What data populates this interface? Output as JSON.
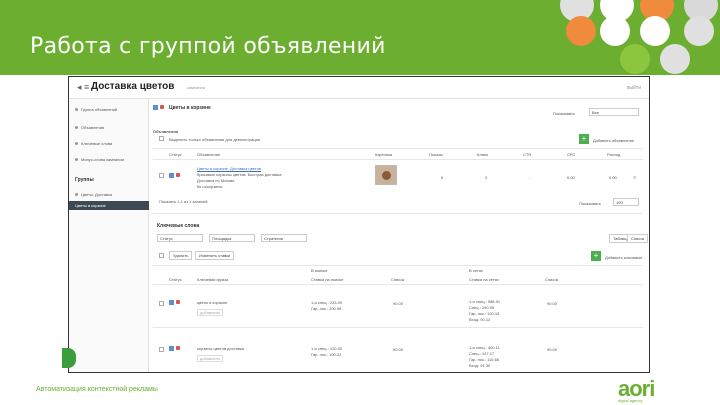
{
  "slide": {
    "title": "Работа с группой объявлений",
    "footer": "Автоматизация контекстной рекламы",
    "logo": "aori",
    "logo_sub": "digital agency",
    "colors": {
      "brand": "#6cae30"
    }
  },
  "app": {
    "back_icon": "back-arrow-icon",
    "title": "Доставка цветов",
    "subtitle": "кампания",
    "top_right": "выйти"
  },
  "sidebar": {
    "items": [
      {
        "label": "Группа объявлений"
      },
      {
        "label": "Объявления"
      },
      {
        "label": "Ключевые слова"
      },
      {
        "label": "Минус-слова кампании"
      }
    ],
    "section": "Группы",
    "sub_items": [
      {
        "label": "Цветы. Доставка"
      },
      {
        "label": "Цветы в корзине"
      }
    ]
  },
  "ads": {
    "group_title": "Цветы в корзине",
    "show_label": "Показывать",
    "show_value": "Все",
    "section_label": "Объявления",
    "filter_label": "Выделить только объявления для демонстрации",
    "add_label": "Добавить объявление",
    "columns": [
      "Статус",
      "Объявление",
      "Картинка",
      "Показы",
      "Клики",
      "CTR",
      "CPC",
      "Расход"
    ],
    "rows": [
      {
        "title": "Цветы в корзине. Доставка цветов",
        "line2": "Красивые корзины цветов. Быстрая доставка",
        "line3": "Доставка по Москве",
        "line4": "flo.ru/корзины",
        "shows": "0",
        "clicks": "2",
        "ctr": "-",
        "cpc": "0.00",
        "cost": "0.00"
      }
    ],
    "pager": "Показать 1-1 из 1 записей",
    "per_page_label": "Показывать",
    "per_page_value": "100"
  },
  "keywords": {
    "section_label": "Ключевые слова",
    "filters": [
      "Статус",
      "Площадка",
      "Стратегия"
    ],
    "view_toggle": [
      "Таблица",
      "Список"
    ],
    "bulk_button": "Удалить",
    "edit_button": "Изменить ставки",
    "add_label": "Добавить ключевые",
    "group_search": "В поиске",
    "group_network": "В сетях",
    "columns": [
      "Статус",
      "Ключевая фраза",
      "Ставка на поиске",
      "Список",
      "Ставка на сетях",
      "Список"
    ],
    "rows": [
      {
        "phrase": "цветы в корзине",
        "tag": "добавлено",
        "bid1": "1-я спец.: 233.09",
        "bid2": "Гар. пок.: 200.98",
        "list": "90.00",
        "net1": "1-я спец.: 986.91",
        "net2": "Спец.: 190.95",
        "net3": "Гар. пок.: 120.15",
        "net4": "Вход: 90.13",
        "cost": "90.00"
      },
      {
        "phrase": "корзины цветов доставка",
        "tag": "добавлено",
        "bid1": "1-я спец.: 120.00",
        "bid2": "Гар. пок.: 100.22",
        "list": "90.00",
        "net1": "1-я спец.: 400.11",
        "net2": "Спец.: 147.17",
        "net3": "Гар. пок.: 110.66",
        "net4": "Вход: 91.30",
        "cost": "90.00"
      }
    ]
  }
}
